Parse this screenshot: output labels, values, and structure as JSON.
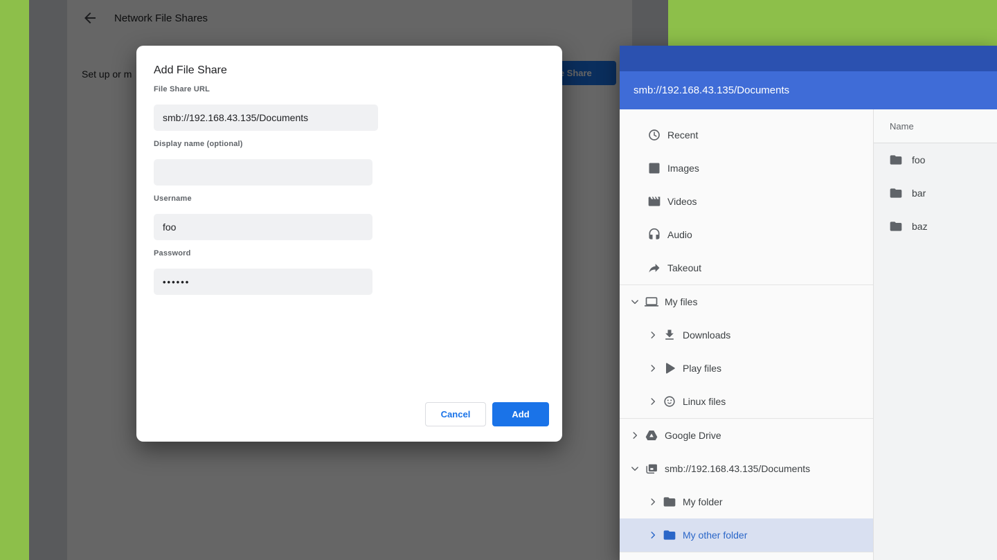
{
  "colors": {
    "wallpaper_green": "#8dbf4a",
    "files_titlebar_blue": "#2b51b0",
    "files_toolbar_blue": "#3f6cd7",
    "accent_blue": "#1a73e8",
    "selected_row_bg": "#d9e0f1",
    "selected_row_text": "#2a66c8"
  },
  "settings_page": {
    "title": "Network File Shares",
    "intro_text_visible": "Set up or m",
    "add_share_button_visible": "le Share"
  },
  "dialog": {
    "title": "Add File Share",
    "fields": [
      {
        "label": "File Share URL",
        "value": "smb://192.168.43.135/Documents"
      },
      {
        "label": "Display name (optional)",
        "value": ""
      },
      {
        "label": "Username",
        "value": "foo"
      },
      {
        "label": "Password",
        "value": "••••••"
      }
    ],
    "buttons": {
      "cancel": "Cancel",
      "add": "Add"
    }
  },
  "files_app": {
    "toolbar_path": "smb://192.168.43.135/Documents",
    "sidebar": {
      "sections": [
        {
          "items": [
            {
              "label": "Recent",
              "icon": "clock"
            },
            {
              "label": "Images",
              "icon": "image"
            },
            {
              "label": "Videos",
              "icon": "movie"
            },
            {
              "label": "Audio",
              "icon": "headset"
            },
            {
              "label": "Takeout",
              "icon": "takeout-arrow"
            }
          ]
        },
        {
          "items": [
            {
              "label": "My files",
              "icon": "laptop",
              "expanded": true
            },
            {
              "label": "Downloads",
              "icon": "download",
              "nested": true
            },
            {
              "label": "Play files",
              "icon": "play",
              "nested": true
            },
            {
              "label": "Linux files",
              "icon": "penguin",
              "nested": true
            }
          ]
        },
        {
          "items": [
            {
              "label": "Google Drive",
              "icon": "google-drive"
            },
            {
              "label": "smb://192.168.43.135/Documents",
              "icon": "shared-folder",
              "expanded": true
            },
            {
              "label": "My folder",
              "icon": "folder",
              "nested": true
            },
            {
              "label": "My other folder",
              "icon": "folder",
              "nested": true,
              "selected": true
            }
          ]
        }
      ]
    },
    "file_list": {
      "name_header": "Name",
      "items": [
        {
          "name": "foo"
        },
        {
          "name": "bar"
        },
        {
          "name": "baz"
        }
      ]
    }
  }
}
